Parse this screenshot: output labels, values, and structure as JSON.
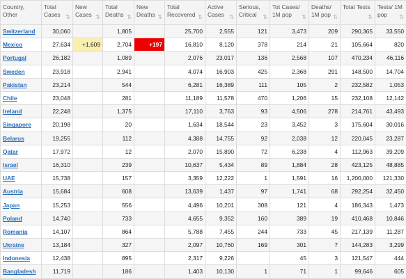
{
  "headers": [
    "Country, Other",
    "Total Cases",
    "New Cases",
    "Total Deaths",
    "New Deaths",
    "Total Recovered",
    "Active Cases",
    "Serious, Critical",
    "Tot Cases/ 1M pop",
    "Deaths/ 1M pop",
    "Total Tests",
    "Tests/ 1M pop"
  ],
  "sort_icon": "sort-arrows",
  "rows": [
    {
      "country": "Switzerland",
      "total_cases": "30,060",
      "new_cases": "",
      "total_deaths": "1,805",
      "new_deaths": "",
      "total_recovered": "25,700",
      "active_cases": "2,555",
      "serious": "121",
      "cases_per_1m": "3,473",
      "deaths_per_1m": "209",
      "total_tests": "290,365",
      "tests_per_1m": "33,550"
    },
    {
      "country": "Mexico",
      "total_cases": "27,634",
      "new_cases": "+1,609",
      "total_deaths": "2,704",
      "new_deaths": "+197",
      "total_recovered": "16,810",
      "active_cases": "8,120",
      "serious": "378",
      "cases_per_1m": "214",
      "deaths_per_1m": "21",
      "total_tests": "105,664",
      "tests_per_1m": "820"
    },
    {
      "country": "Portugal",
      "total_cases": "26,182",
      "new_cases": "",
      "total_deaths": "1,089",
      "new_deaths": "",
      "total_recovered": "2,076",
      "active_cases": "23,017",
      "serious": "136",
      "cases_per_1m": "2,568",
      "deaths_per_1m": "107",
      "total_tests": "470,234",
      "tests_per_1m": "46,116"
    },
    {
      "country": "Sweden",
      "total_cases": "23,918",
      "new_cases": "",
      "total_deaths": "2,941",
      "new_deaths": "",
      "total_recovered": "4,074",
      "active_cases": "16,903",
      "serious": "425",
      "cases_per_1m": "2,368",
      "deaths_per_1m": "291",
      "total_tests": "148,500",
      "tests_per_1m": "14,704"
    },
    {
      "country": "Pakistan",
      "total_cases": "23,214",
      "new_cases": "",
      "total_deaths": "544",
      "new_deaths": "",
      "total_recovered": "6,281",
      "active_cases": "16,389",
      "serious": "111",
      "cases_per_1m": "105",
      "deaths_per_1m": "2",
      "total_tests": "232,582",
      "tests_per_1m": "1,053"
    },
    {
      "country": "Chile",
      "total_cases": "23,048",
      "new_cases": "",
      "total_deaths": "281",
      "new_deaths": "",
      "total_recovered": "11,189",
      "active_cases": "11,578",
      "serious": "470",
      "cases_per_1m": "1,206",
      "deaths_per_1m": "15",
      "total_tests": "232,108",
      "tests_per_1m": "12,142"
    },
    {
      "country": "Ireland",
      "total_cases": "22,248",
      "new_cases": "",
      "total_deaths": "1,375",
      "new_deaths": "",
      "total_recovered": "17,110",
      "active_cases": "3,763",
      "serious": "93",
      "cases_per_1m": "4,506",
      "deaths_per_1m": "278",
      "total_tests": "214,761",
      "tests_per_1m": "43,493"
    },
    {
      "country": "Singapore",
      "total_cases": "20,198",
      "new_cases": "",
      "total_deaths": "20",
      "new_deaths": "",
      "total_recovered": "1,634",
      "active_cases": "18,544",
      "serious": "23",
      "cases_per_1m": "3,452",
      "deaths_per_1m": "3",
      "total_tests": "175,604",
      "tests_per_1m": "30,016"
    },
    {
      "country": "Belarus",
      "total_cases": "19,255",
      "new_cases": "",
      "total_deaths": "112",
      "new_deaths": "",
      "total_recovered": "4,388",
      "active_cases": "14,755",
      "serious": "92",
      "cases_per_1m": "2,038",
      "deaths_per_1m": "12",
      "total_tests": "220,045",
      "tests_per_1m": "23,287"
    },
    {
      "country": "Qatar",
      "total_cases": "17,972",
      "new_cases": "",
      "total_deaths": "12",
      "new_deaths": "",
      "total_recovered": "2,070",
      "active_cases": "15,890",
      "serious": "72",
      "cases_per_1m": "6,238",
      "deaths_per_1m": "4",
      "total_tests": "112,963",
      "tests_per_1m": "39,209"
    },
    {
      "country": "Israel",
      "total_cases": "16,310",
      "new_cases": "",
      "total_deaths": "239",
      "new_deaths": "",
      "total_recovered": "10,637",
      "active_cases": "5,434",
      "serious": "89",
      "cases_per_1m": "1,884",
      "deaths_per_1m": "28",
      "total_tests": "423,125",
      "tests_per_1m": "48,885"
    },
    {
      "country": "UAE",
      "total_cases": "15,738",
      "new_cases": "",
      "total_deaths": "157",
      "new_deaths": "",
      "total_recovered": "3,359",
      "active_cases": "12,222",
      "serious": "1",
      "cases_per_1m": "1,591",
      "deaths_per_1m": "16",
      "total_tests": "1,200,000",
      "tests_per_1m": "121,330"
    },
    {
      "country": "Austria",
      "total_cases": "15,684",
      "new_cases": "",
      "total_deaths": "608",
      "new_deaths": "",
      "total_recovered": "13,639",
      "active_cases": "1,437",
      "serious": "97",
      "cases_per_1m": "1,741",
      "deaths_per_1m": "68",
      "total_tests": "292,254",
      "tests_per_1m": "32,450"
    },
    {
      "country": "Japan",
      "total_cases": "15,253",
      "new_cases": "",
      "total_deaths": "556",
      "new_deaths": "",
      "total_recovered": "4,496",
      "active_cases": "10,201",
      "serious": "308",
      "cases_per_1m": "121",
      "deaths_per_1m": "4",
      "total_tests": "186,343",
      "tests_per_1m": "1,473"
    },
    {
      "country": "Poland",
      "total_cases": "14,740",
      "new_cases": "",
      "total_deaths": "733",
      "new_deaths": "",
      "total_recovered": "4,655",
      "active_cases": "9,352",
      "serious": "160",
      "cases_per_1m": "389",
      "deaths_per_1m": "19",
      "total_tests": "410,468",
      "tests_per_1m": "10,846"
    },
    {
      "country": "Romania",
      "total_cases": "14,107",
      "new_cases": "",
      "total_deaths": "864",
      "new_deaths": "",
      "total_recovered": "5,788",
      "active_cases": "7,455",
      "serious": "244",
      "cases_per_1m": "733",
      "deaths_per_1m": "45",
      "total_tests": "217,139",
      "tests_per_1m": "11,287"
    },
    {
      "country": "Ukraine",
      "total_cases": "13,184",
      "new_cases": "",
      "total_deaths": "327",
      "new_deaths": "",
      "total_recovered": "2,097",
      "active_cases": "10,760",
      "serious": "169",
      "cases_per_1m": "301",
      "deaths_per_1m": "7",
      "total_tests": "144,283",
      "tests_per_1m": "3,299"
    },
    {
      "country": "Indonesia",
      "total_cases": "12,438",
      "new_cases": "",
      "total_deaths": "895",
      "new_deaths": "",
      "total_recovered": "2,317",
      "active_cases": "9,226",
      "serious": "",
      "cases_per_1m": "45",
      "deaths_per_1m": "3",
      "total_tests": "121,547",
      "tests_per_1m": "444"
    },
    {
      "country": "Bangladesh",
      "total_cases": "11,719",
      "new_cases": "",
      "total_deaths": "186",
      "new_deaths": "",
      "total_recovered": "1,403",
      "active_cases": "10,130",
      "serious": "1",
      "cases_per_1m": "71",
      "deaths_per_1m": "1",
      "total_tests": "99,646",
      "tests_per_1m": "605"
    }
  ]
}
